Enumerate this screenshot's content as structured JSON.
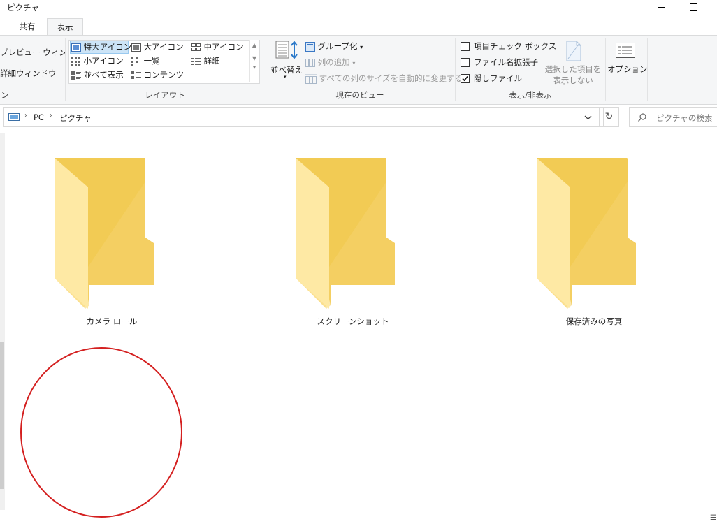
{
  "window": {
    "title": "ピクチャ"
  },
  "tabs": [
    {
      "label": "共有"
    },
    {
      "label": "表示"
    }
  ],
  "ribbon": {
    "panes": {
      "preview_label": "プレビュー ウィンドウ",
      "details_label": "詳細ウィンドウ",
      "group_label": "ン"
    },
    "layout": {
      "items": [
        {
          "label": "特大アイコン"
        },
        {
          "label": "大アイコン"
        },
        {
          "label": "中アイコン"
        },
        {
          "label": "小アイコン"
        },
        {
          "label": "一覧"
        },
        {
          "label": "詳細"
        },
        {
          "label": "並べて表示"
        },
        {
          "label": "コンテンツ"
        }
      ],
      "group_label": "レイアウト"
    },
    "current_view": {
      "sort_label": "並べ替え",
      "group_by": "グループ化",
      "add_column": "列の追加",
      "fit_columns": "すべての列のサイズを自動的に変更する",
      "group_label": "現在のビュー"
    },
    "show_hide": {
      "item_checkboxes": {
        "label": "項目チェック ボックス",
        "checked": false
      },
      "file_extensions": {
        "label": "ファイル名拡張子",
        "checked": false
      },
      "hidden_items": {
        "label": "隠しファイル",
        "checked": true
      },
      "hide_selected_line1": "選択した項目を",
      "hide_selected_line2": "表示しない",
      "group_label": "表示/非表示"
    },
    "options_label": "オプション"
  },
  "address": {
    "crumbs": [
      {
        "label": "PC"
      },
      {
        "label": "ピクチャ"
      }
    ],
    "search_placeholder": "ピクチャの検索"
  },
  "folders": [
    {
      "name": "カメラ ロール"
    },
    {
      "name": "スクリーンショット"
    },
    {
      "name": "保存済みの写真"
    }
  ],
  "colors": {
    "folder_light": "#fde79a",
    "folder_dark": "#f2c94c",
    "annotation": "#d42020",
    "selection": "#cce4f7"
  }
}
